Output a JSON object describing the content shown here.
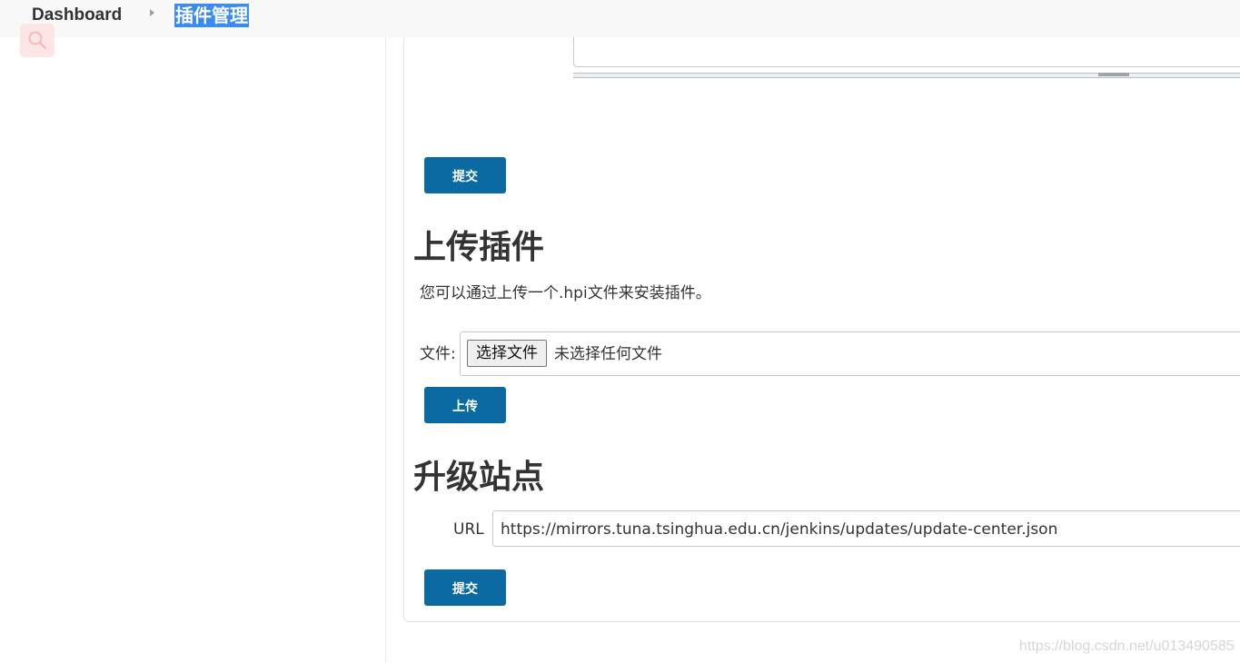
{
  "header": {
    "breadcrumb_root": "Dashboard",
    "breadcrumb_current": "插件管理",
    "search_icon": "search-icon"
  },
  "advanced_settings": {
    "submit_label": "提交"
  },
  "upload": {
    "title": "上传插件",
    "description": "您可以通过上传一个.hpi文件来安装插件。",
    "file_label": "文件:",
    "choose_button": "选择文件",
    "file_status": "未选择任何文件",
    "upload_button": "上传"
  },
  "update_site": {
    "title": "升级站点",
    "url_label": "URL",
    "url_value": "https://mirrors.tuna.tsinghua.edu.cn/jenkins/updates/update-center.json",
    "submit_label": "提交"
  },
  "watermark": "https://blog.csdn.net/u013490585",
  "colors": {
    "primary_button": "#0b6aa2",
    "breadcrumb_highlight": "#3b8cf0",
    "search_button_bg": "#fde5e5"
  }
}
